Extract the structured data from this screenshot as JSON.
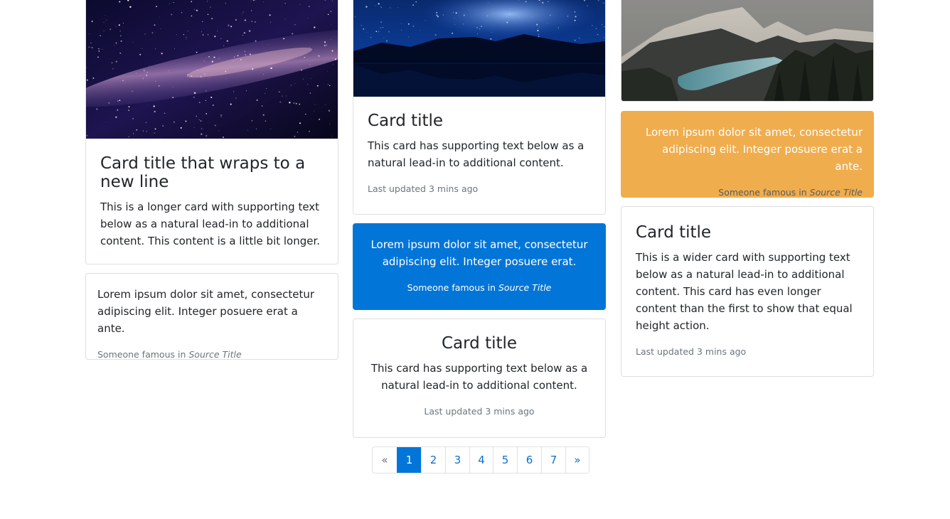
{
  "colors": {
    "primary": "#0275d8",
    "warning": "#f0ad4e",
    "muted": "#6c757d",
    "border": "#dfdfdf"
  },
  "column1": {
    "image_card": {
      "image": "milky-way-night-sky-image",
      "title": "Card title that wraps to a new line",
      "text": "This is a longer card with supporting text below as a natural lead-in to additional content. This content is a little bit longer."
    },
    "quote_card": {
      "text": "Lorem ipsum dolor sit amet, consectetur adipiscing elit. Integer posuere erat a ante.",
      "cite_prefix": "Someone famous in",
      "cite_source": "Source Title"
    }
  },
  "column2": {
    "image_card": {
      "image": "starry-mountain-lake-image",
      "title": "Card title",
      "text": "This card has supporting text below as a natural lead-in to additional content.",
      "updated": "Last updated 3 mins ago"
    },
    "primary_quote_card": {
      "text": "Lorem ipsum dolor sit amet, consectetur adipiscing elit. Integer posuere erat.",
      "cite_prefix": "Someone famous in",
      "cite_source": "Source Title"
    },
    "center_card": {
      "title": "Card title",
      "text": "This card has supporting text below as a natural lead-in to additional content.",
      "updated": "Last updated 3 mins ago"
    }
  },
  "column3": {
    "image_card": {
      "image": "mountain-lake-valley-image"
    },
    "warning_quote_card": {
      "text": "Lorem ipsum dolor sit amet, consectetur adipiscing elit. Integer posuere erat a ante.",
      "cite_prefix": "Someone famous in",
      "cite_source": "Source Title"
    },
    "wide_card": {
      "title": "Card title",
      "text": "This is a wider card with supporting text below as a natural lead-in to additional content. This card has even longer content than the first to show that equal height action.",
      "updated": "Last updated 3 mins ago"
    }
  },
  "pagination": {
    "prev": "«",
    "pages": [
      "1",
      "2",
      "3",
      "4",
      "5",
      "6",
      "7"
    ],
    "active_page": "1",
    "next": "»"
  }
}
